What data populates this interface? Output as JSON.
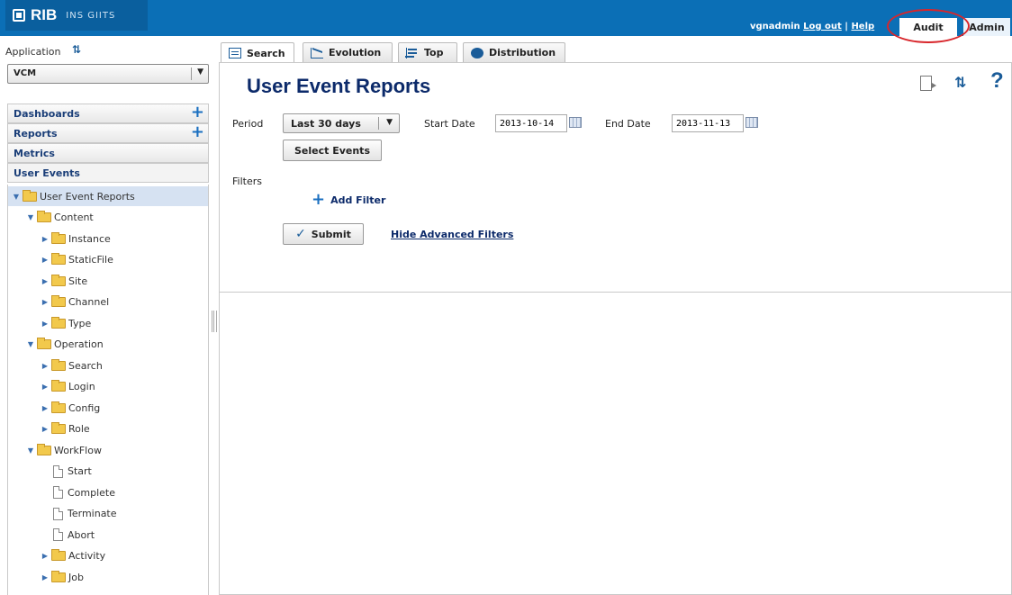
{
  "header": {
    "brand": "RIB",
    "subtitle": "INS GIITS",
    "username": "vgnadmin",
    "logout_label": "Log out",
    "separator": "|",
    "help_label": "Help",
    "tabs": [
      {
        "label": "Audit",
        "active": true
      },
      {
        "label": "Admin",
        "active": false
      }
    ]
  },
  "sidebar": {
    "application_label": "Application",
    "application_value": "VCM",
    "sections": [
      {
        "label": "Dashboards",
        "has_add": true
      },
      {
        "label": "Reports",
        "has_add": true
      },
      {
        "label": "Metrics",
        "has_add": false
      },
      {
        "label": "User Events",
        "has_add": false
      }
    ],
    "tree": [
      {
        "label": "User Event Reports",
        "level": 0,
        "type": "folder",
        "expanded": true,
        "selected": true
      },
      {
        "label": "Content",
        "level": 1,
        "type": "folder",
        "expanded": true
      },
      {
        "label": "Instance",
        "level": 2,
        "type": "folder",
        "expanded": false
      },
      {
        "label": "StaticFile",
        "level": 2,
        "type": "folder",
        "expanded": false
      },
      {
        "label": "Site",
        "level": 2,
        "type": "folder",
        "expanded": false
      },
      {
        "label": "Channel",
        "level": 2,
        "type": "folder",
        "expanded": false
      },
      {
        "label": "Type",
        "level": 2,
        "type": "folder",
        "expanded": false
      },
      {
        "label": "Operation",
        "level": 1,
        "type": "folder",
        "expanded": true
      },
      {
        "label": "Search",
        "level": 2,
        "type": "folder",
        "expanded": false
      },
      {
        "label": "Login",
        "level": 2,
        "type": "folder",
        "expanded": false
      },
      {
        "label": "Config",
        "level": 2,
        "type": "folder",
        "expanded": false
      },
      {
        "label": "Role",
        "level": 2,
        "type": "folder",
        "expanded": false
      },
      {
        "label": "WorkFlow",
        "level": 1,
        "type": "folder",
        "expanded": true
      },
      {
        "label": "Start",
        "level": 2,
        "type": "file"
      },
      {
        "label": "Complete",
        "level": 2,
        "type": "file"
      },
      {
        "label": "Terminate",
        "level": 2,
        "type": "file"
      },
      {
        "label": "Abort",
        "level": 2,
        "type": "file"
      },
      {
        "label": "Activity",
        "level": 2,
        "type": "folder",
        "expanded": false
      },
      {
        "label": "Job",
        "level": 2,
        "type": "folder",
        "expanded": false
      }
    ]
  },
  "main": {
    "tabs": [
      {
        "label": "Search",
        "icon": "search-tab-icon",
        "active": true
      },
      {
        "label": "Evolution",
        "icon": "line-chart-icon",
        "active": false
      },
      {
        "label": "Top",
        "icon": "bar-chart-icon",
        "active": false
      },
      {
        "label": "Distribution",
        "icon": "pie-chart-icon",
        "active": false
      }
    ],
    "title": "User Event Reports",
    "form": {
      "period_label": "Period",
      "period_value": "Last 30 days",
      "start_date_label": "Start Date",
      "start_date_value": "2013-10-14",
      "end_date_label": "End Date",
      "end_date_value": "2013-11-13",
      "select_events_label": "Select Events",
      "filters_label": "Filters",
      "add_filter_label": "Add Filter",
      "submit_label": "Submit",
      "hide_filters_label": "Hide Advanced Filters"
    }
  },
  "colors": {
    "header_blue": "#0b6fb6",
    "title_navy": "#0c2a6a",
    "highlight_red": "#d8262b",
    "tree_selected": "#d6e2f2"
  }
}
